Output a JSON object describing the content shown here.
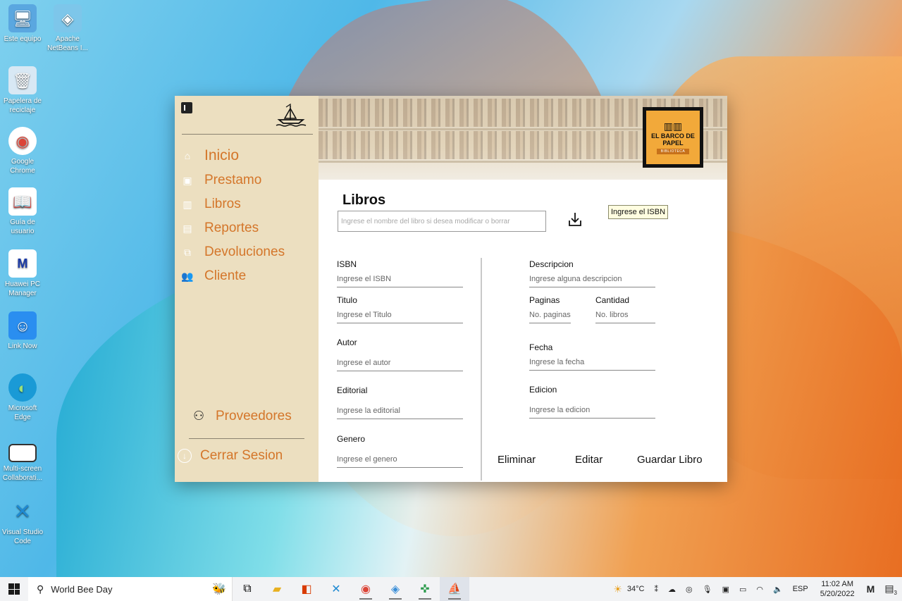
{
  "desktop": {
    "icons": [
      {
        "label": "Este equipo",
        "icon": "computer-icon"
      },
      {
        "label": "Apache NetBeans I...",
        "icon": "netbeans-icon"
      },
      {
        "label": "Papelera de reciclaje",
        "icon": "recycle-bin-icon"
      },
      {
        "label": "Google Chrome",
        "icon": "chrome-icon"
      },
      {
        "label": "Guía de usuario",
        "icon": "user-guide-icon"
      },
      {
        "label": "Huawei PC Manager",
        "icon": "huawei-icon"
      },
      {
        "label": "Link Now",
        "icon": "link-now-icon"
      },
      {
        "label": "Microsoft Edge",
        "icon": "edge-icon"
      },
      {
        "label": "Multi-screen Collaborati...",
        "icon": "multiscreen-icon"
      },
      {
        "label": "Visual Studio Code",
        "icon": "vscode-icon"
      }
    ]
  },
  "sidebar": {
    "items": [
      {
        "label": "Inicio",
        "icon": "home-icon"
      },
      {
        "label": "Prestamo",
        "icon": "calendar-plus-icon"
      },
      {
        "label": "Libros",
        "icon": "book-icon"
      },
      {
        "label": "Reportes",
        "icon": "report-icon"
      },
      {
        "label": "Devoluciones",
        "icon": "return-icon"
      },
      {
        "label": "Cliente",
        "icon": "users-icon"
      }
    ],
    "suppliers_label": "Proveedores",
    "logout_label": "Cerrar Sesion"
  },
  "header": {
    "logo_title": "EL BARCO DE PAPEL",
    "logo_subtitle": "BIBLIOTECA"
  },
  "main": {
    "title": "Libros",
    "search_placeholder": "Ingrese el nombre del libro si desea modificar o borrar",
    "tooltip": "Ingrese el ISBN",
    "fields": {
      "isbn": {
        "label": "ISBN",
        "placeholder": "Ingrese el ISBN"
      },
      "titulo": {
        "label": "Titulo",
        "placeholder": "Ingrese el Titulo"
      },
      "autor": {
        "label": "Autor",
        "placeholder": "Ingrese el autor"
      },
      "editorial": {
        "label": "Editorial",
        "placeholder": "Ingrese la editorial"
      },
      "genero": {
        "label": "Genero",
        "placeholder": "Ingrese el genero"
      },
      "descripcion": {
        "label": "Descripcion",
        "placeholder": "Ingrese alguna descripcion"
      },
      "paginas": {
        "label": "Paginas",
        "placeholder": "No. paginas"
      },
      "cantidad": {
        "label": "Cantidad",
        "placeholder": "No. libros"
      },
      "fecha": {
        "label": "Fecha",
        "placeholder": "Ingrese la fecha"
      },
      "edicion": {
        "label": "Edicion",
        "placeholder": "Ingrese la edicion"
      }
    },
    "buttons": {
      "delete": "Eliminar",
      "edit": "Editar",
      "save": "Guardar Libro"
    }
  },
  "taskbar": {
    "search_text": "World Bee Day",
    "weather": "34°C",
    "language": "ESP",
    "time": "11:02 AM",
    "date": "5/20/2022",
    "notification_count": "3"
  }
}
